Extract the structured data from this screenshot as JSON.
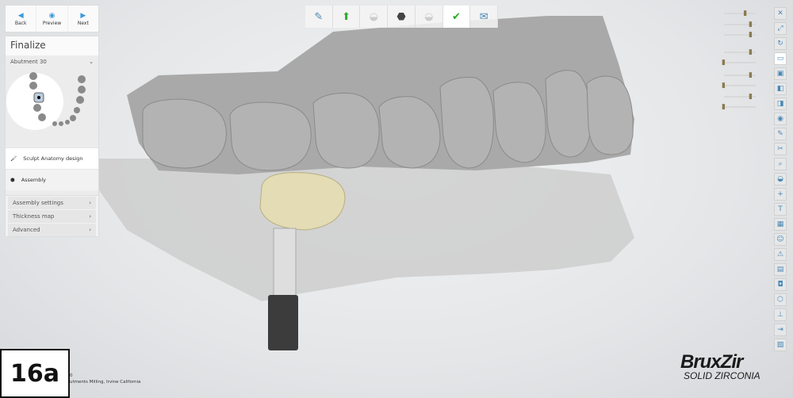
{
  "nav": {
    "back": "Back",
    "preview": "Preview",
    "next": "Next"
  },
  "finalize": {
    "title": "Finalize",
    "selection": "Abutment 30"
  },
  "steps": [
    {
      "label": "Sculpt Anatomy design",
      "icon": "sculpt-tool-icon"
    },
    {
      "label": "Assembly",
      "icon": "assembly-icon"
    }
  ],
  "menu": [
    {
      "label": "Assembly settings"
    },
    {
      "label": "Thickness map"
    },
    {
      "label": "Advanced"
    }
  ],
  "workflow": [
    {
      "icon": "scan-icon"
    },
    {
      "icon": "margin-icon"
    },
    {
      "icon": "crown-icon"
    },
    {
      "icon": "abutment-icon"
    },
    {
      "icon": "crown-design-icon"
    },
    {
      "icon": "crown-finalize-icon"
    },
    {
      "icon": "export-icon"
    }
  ],
  "figure_label": "16a",
  "credit": {
    "line1": "0",
    "line2": "utments Milling, Irvine California"
  },
  "logo": {
    "brand": "BruxZir",
    "sub": "SOLID ZIRCONIA"
  },
  "sliders": [
    {
      "value": 0.8
    },
    {
      "value": 1.0
    },
    {
      "value": 1.0
    },
    {
      "value": 1.0
    },
    {
      "value": 0.0
    },
    {
      "value": 1.0
    },
    {
      "value": 0.0
    },
    {
      "value": 1.0
    },
    {
      "value": 0.0
    }
  ],
  "colors": {
    "accent": "#3a9ad9",
    "crown": "#e3dcb4"
  }
}
